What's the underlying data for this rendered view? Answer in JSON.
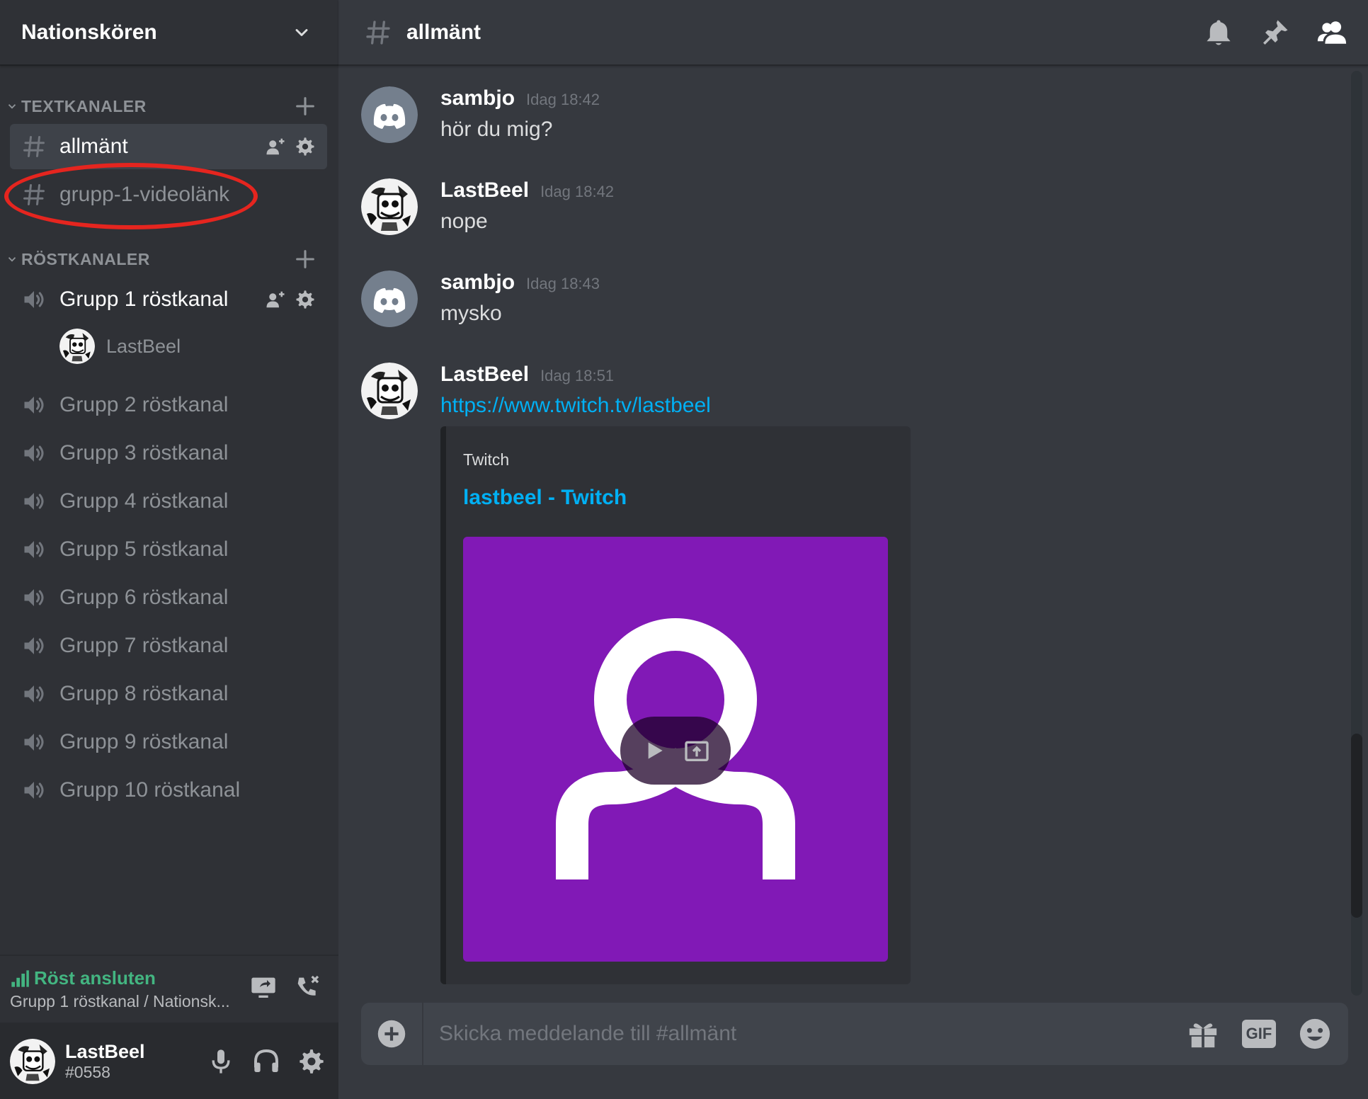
{
  "server": {
    "name": "Nationskören"
  },
  "categories": {
    "text": "TEXTKANALER",
    "voice": "RÖSTKANALER"
  },
  "text_channels": [
    {
      "name": "allmänt"
    },
    {
      "name": "grupp-1-videolänk"
    }
  ],
  "voice_channels": [
    {
      "name": "Grupp 1 röstkanal"
    },
    {
      "name": "Grupp 2 röstkanal"
    },
    {
      "name": "Grupp 3 röstkanal"
    },
    {
      "name": "Grupp 4 röstkanal"
    },
    {
      "name": "Grupp 5 röstkanal"
    },
    {
      "name": "Grupp 6 röstkanal"
    },
    {
      "name": "Grupp 7 röstkanal"
    },
    {
      "name": "Grupp 8 röstkanal"
    },
    {
      "name": "Grupp 9 röstkanal"
    },
    {
      "name": "Grupp 10 röstkanal"
    }
  ],
  "voice_member": "LastBeel",
  "voice_panel": {
    "status": "Röst ansluten",
    "channel": "Grupp 1 röstkanal / Nationsk..."
  },
  "user": {
    "name": "LastBeel",
    "tag": "#0558"
  },
  "header": {
    "channel": "allmänt"
  },
  "messages": [
    {
      "author": "sambjo",
      "time": "Idag 18:42",
      "text": "hör du mig?"
    },
    {
      "author": "LastBeel",
      "time": "Idag 18:42",
      "text": "nope"
    },
    {
      "author": "sambjo",
      "time": "Idag 18:43",
      "text": "mysko"
    },
    {
      "author": "LastBeel",
      "time": "Idag 18:51",
      "text": "https://www.twitch.tv/lastbeel"
    }
  ],
  "embed": {
    "provider": "Twitch",
    "title": "lastbeel - Twitch"
  },
  "composer": {
    "placeholder": "Skicka meddelande till #allmänt",
    "gif_label": "GIF"
  },
  "colors": {
    "accent_link": "#00b0f4",
    "connected": "#43b581",
    "embed_bg": "#8119b6",
    "annotation": "#e5251f"
  }
}
